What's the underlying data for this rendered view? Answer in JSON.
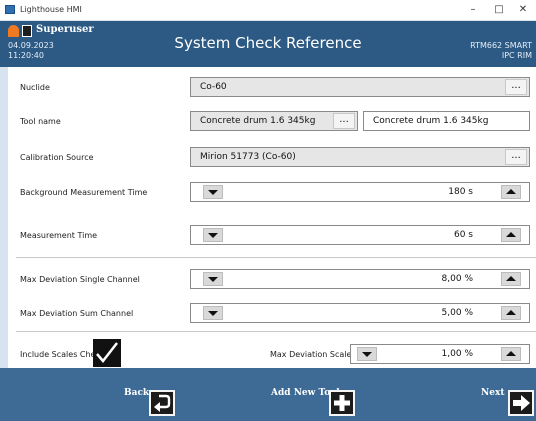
{
  "window": {
    "title": "Lighthouse HMI",
    "minimize_glyph": "–",
    "maximize_glyph": "□",
    "close_glyph": "✕"
  },
  "header": {
    "user": "Superuser",
    "date": "04.09.2023",
    "time": "11:20:40",
    "title": "System Check Reference",
    "device": "RTM662 SMART",
    "subdevice": "IPC RIM"
  },
  "form": {
    "nuclide": {
      "label": "Nuclide",
      "value": "Co-60",
      "browse": "..."
    },
    "tool_name": {
      "label": "Tool name",
      "value": "Concrete drum 1.6 345kg",
      "browse": "...",
      "text_value": "Concrete drum 1.6 345kg"
    },
    "calibration_source": {
      "label": "Calibration Source",
      "value": "Mirion 51773 (Co-60)",
      "browse": "..."
    },
    "background_time": {
      "label": "Background Measurement Time",
      "value": "180 s"
    },
    "measurement_time": {
      "label": "Measurement Time",
      "value": "60 s"
    },
    "max_dev_single": {
      "label": "Max Deviation Single Channel",
      "value": "8,00 %"
    },
    "max_dev_sum": {
      "label": "Max Deviation Sum Channel",
      "value": "5,00 %"
    },
    "include_scales": {
      "label": "Include Scales Check",
      "checked": true
    },
    "max_dev_scales": {
      "label": "Max Deviation Scales",
      "value": "1,00 %"
    }
  },
  "footer": {
    "back": "Back",
    "add_new_tool": "Add New Tool",
    "next": "Next"
  },
  "icons": {
    "app": "window-app-icon",
    "logo": "lighthouse-logo-icon",
    "user": "user-icon",
    "down": "triangle-down-icon",
    "up": "triangle-up-icon",
    "check": "checkmark-icon",
    "back": "undo-arrow-icon",
    "add": "plus-icon",
    "next": "right-arrow-icon"
  },
  "colors": {
    "header": "#2d5a84",
    "footer": "#3d6b95",
    "logo": "#f07a22"
  }
}
